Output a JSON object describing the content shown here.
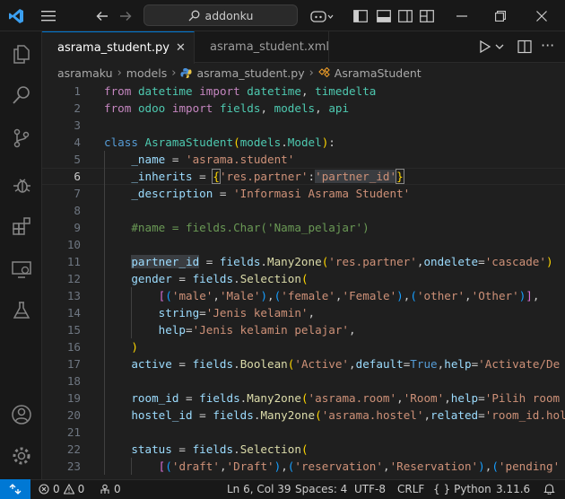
{
  "titlebar": {
    "search_text": "addonku"
  },
  "tabs": [
    {
      "label": "asrama_student.py"
    },
    {
      "label": "asrama_student.xml"
    }
  ],
  "breadcrumb": [
    "asramaku",
    "models",
    "asrama_student.py",
    "AsramaStudent"
  ],
  "editor": {
    "current_line": "6",
    "line_numbers": [
      "1",
      "2",
      "3",
      "4",
      "5",
      "6",
      "7",
      "8",
      "9",
      "10",
      "11",
      "12",
      "13",
      "14",
      "15",
      "16",
      "17",
      "18",
      "19",
      "20",
      "21",
      "22",
      "23"
    ],
    "lines": [
      [
        [
          "kw",
          "from"
        ],
        [
          "plain",
          " "
        ],
        [
          "cls",
          "datetime"
        ],
        [
          "plain",
          " "
        ],
        [
          "kw",
          "import"
        ],
        [
          "plain",
          " "
        ],
        [
          "cls",
          "datetime"
        ],
        [
          "plain",
          ", "
        ],
        [
          "cls",
          "timedelta"
        ]
      ],
      [
        [
          "kw",
          "from"
        ],
        [
          "plain",
          " "
        ],
        [
          "cls",
          "odoo"
        ],
        [
          "plain",
          " "
        ],
        [
          "kw",
          "import"
        ],
        [
          "plain",
          " "
        ],
        [
          "cls",
          "fields"
        ],
        [
          "plain",
          ", "
        ],
        [
          "cls",
          "models"
        ],
        [
          "plain",
          ", "
        ],
        [
          "cls",
          "api"
        ]
      ],
      [],
      [
        [
          "def",
          "class"
        ],
        [
          "plain",
          " "
        ],
        [
          "cls",
          "AsramaStudent"
        ],
        [
          "b1",
          "("
        ],
        [
          "cls",
          "models"
        ],
        [
          "plain",
          "."
        ],
        [
          "cls",
          "Model"
        ],
        [
          "b1",
          ")"
        ],
        [
          "plain",
          ":"
        ]
      ],
      [
        [
          "plain",
          "    "
        ],
        [
          "var",
          "_name"
        ],
        [
          "plain",
          " = "
        ],
        [
          "str",
          "'asrama.student'"
        ]
      ],
      [
        [
          "plain",
          "    "
        ],
        [
          "var",
          "_inherits"
        ],
        [
          "plain",
          " = "
        ],
        [
          "b1",
          "{"
        ],
        [
          "str",
          "'res.partner'"
        ],
        [
          "plain",
          ":"
        ],
        [
          "str",
          "'partner_id'"
        ],
        [
          "b1",
          "}"
        ]
      ],
      [
        [
          "plain",
          "    "
        ],
        [
          "var",
          "_description"
        ],
        [
          "plain",
          " = "
        ],
        [
          "str",
          "'Informasi Asrama Student'"
        ]
      ],
      [],
      [
        [
          "plain",
          "    "
        ],
        [
          "cmt",
          "#name = fields.Char('Nama_pelajar')"
        ]
      ],
      [],
      [
        [
          "plain",
          "    "
        ],
        [
          "var",
          "partner_id"
        ],
        [
          "plain",
          " = "
        ],
        [
          "var",
          "fields"
        ],
        [
          "plain",
          "."
        ],
        [
          "fn",
          "Many2one"
        ],
        [
          "b1",
          "("
        ],
        [
          "str",
          "'res.partner'"
        ],
        [
          "plain",
          ","
        ],
        [
          "var",
          "ondelete"
        ],
        [
          "plain",
          "="
        ],
        [
          "str",
          "'cascade'"
        ],
        [
          "b1",
          ")"
        ]
      ],
      [
        [
          "plain",
          "    "
        ],
        [
          "var",
          "gender"
        ],
        [
          "plain",
          " = "
        ],
        [
          "var",
          "fields"
        ],
        [
          "plain",
          "."
        ],
        [
          "fn",
          "Selection"
        ],
        [
          "b1",
          "("
        ]
      ],
      [
        [
          "plain",
          "        "
        ],
        [
          "b2",
          "["
        ],
        [
          "b3",
          "("
        ],
        [
          "str",
          "'male'"
        ],
        [
          "plain",
          ","
        ],
        [
          "str",
          "'Male'"
        ],
        [
          "b3",
          ")"
        ],
        [
          "plain",
          ","
        ],
        [
          "b3",
          "("
        ],
        [
          "str",
          "'female'"
        ],
        [
          "plain",
          ","
        ],
        [
          "str",
          "'Female'"
        ],
        [
          "b3",
          ")"
        ],
        [
          "plain",
          ","
        ],
        [
          "b3",
          "("
        ],
        [
          "str",
          "'other'"
        ],
        [
          "plain",
          ","
        ],
        [
          "str",
          "'Other'"
        ],
        [
          "b3",
          ")"
        ],
        [
          "b2",
          "]"
        ],
        [
          "plain",
          ","
        ]
      ],
      [
        [
          "plain",
          "        "
        ],
        [
          "var",
          "string"
        ],
        [
          "plain",
          "="
        ],
        [
          "str",
          "'Jenis kelamin'"
        ],
        [
          "plain",
          ","
        ]
      ],
      [
        [
          "plain",
          "        "
        ],
        [
          "var",
          "help"
        ],
        [
          "plain",
          "="
        ],
        [
          "str",
          "'Jenis kelamin pelajar'"
        ],
        [
          "plain",
          ","
        ]
      ],
      [
        [
          "plain",
          "    "
        ],
        [
          "b1",
          ")"
        ]
      ],
      [
        [
          "plain",
          "    "
        ],
        [
          "var",
          "active"
        ],
        [
          "plain",
          " = "
        ],
        [
          "var",
          "fields"
        ],
        [
          "plain",
          "."
        ],
        [
          "fn",
          "Boolean"
        ],
        [
          "b1",
          "("
        ],
        [
          "str",
          "'Active'"
        ],
        [
          "plain",
          ","
        ],
        [
          "var",
          "default"
        ],
        [
          "plain",
          "="
        ],
        [
          "def",
          "True"
        ],
        [
          "plain",
          ","
        ],
        [
          "var",
          "help"
        ],
        [
          "plain",
          "="
        ],
        [
          "str",
          "'Activate/De"
        ]
      ],
      [],
      [
        [
          "plain",
          "    "
        ],
        [
          "var",
          "room_id"
        ],
        [
          "plain",
          " = "
        ],
        [
          "var",
          "fields"
        ],
        [
          "plain",
          "."
        ],
        [
          "fn",
          "Many2one"
        ],
        [
          "b1",
          "("
        ],
        [
          "str",
          "'asrama.room'"
        ],
        [
          "plain",
          ","
        ],
        [
          "str",
          "'Room'"
        ],
        [
          "plain",
          ","
        ],
        [
          "var",
          "help"
        ],
        [
          "plain",
          "="
        ],
        [
          "str",
          "'Pilih room"
        ]
      ],
      [
        [
          "plain",
          "    "
        ],
        [
          "var",
          "hostel_id"
        ],
        [
          "plain",
          " = "
        ],
        [
          "var",
          "fields"
        ],
        [
          "plain",
          "."
        ],
        [
          "fn",
          "Many2one"
        ],
        [
          "b1",
          "("
        ],
        [
          "str",
          "'asrama.hostel'"
        ],
        [
          "plain",
          ","
        ],
        [
          "var",
          "related"
        ],
        [
          "plain",
          "="
        ],
        [
          "str",
          "'room_id.hol"
        ]
      ],
      [],
      [
        [
          "plain",
          "    "
        ],
        [
          "var",
          "status"
        ],
        [
          "plain",
          " = "
        ],
        [
          "var",
          "fields"
        ],
        [
          "plain",
          "."
        ],
        [
          "fn",
          "Selection"
        ],
        [
          "b1",
          "("
        ]
      ],
      [
        [
          "plain",
          "        "
        ],
        [
          "b2",
          "["
        ],
        [
          "b3",
          "("
        ],
        [
          "str",
          "'draft'"
        ],
        [
          "plain",
          ","
        ],
        [
          "str",
          "'Draft'"
        ],
        [
          "b3",
          ")"
        ],
        [
          "plain",
          ","
        ],
        [
          "b3",
          "("
        ],
        [
          "str",
          "'reservation'"
        ],
        [
          "plain",
          ","
        ],
        [
          "str",
          "'Reservation'"
        ],
        [
          "b3",
          ")"
        ],
        [
          "plain",
          ","
        ],
        [
          "b3",
          "("
        ],
        [
          "str",
          "'pending'"
        ]
      ]
    ]
  },
  "statusbar": {
    "errors": "0",
    "warnings": "0",
    "ports": "0",
    "position": "Ln 6, Col 39",
    "spaces": "Spaces: 4",
    "encoding": "UTF-8",
    "eol": "CRLF",
    "language": "Python",
    "version": "3.11.6"
  }
}
